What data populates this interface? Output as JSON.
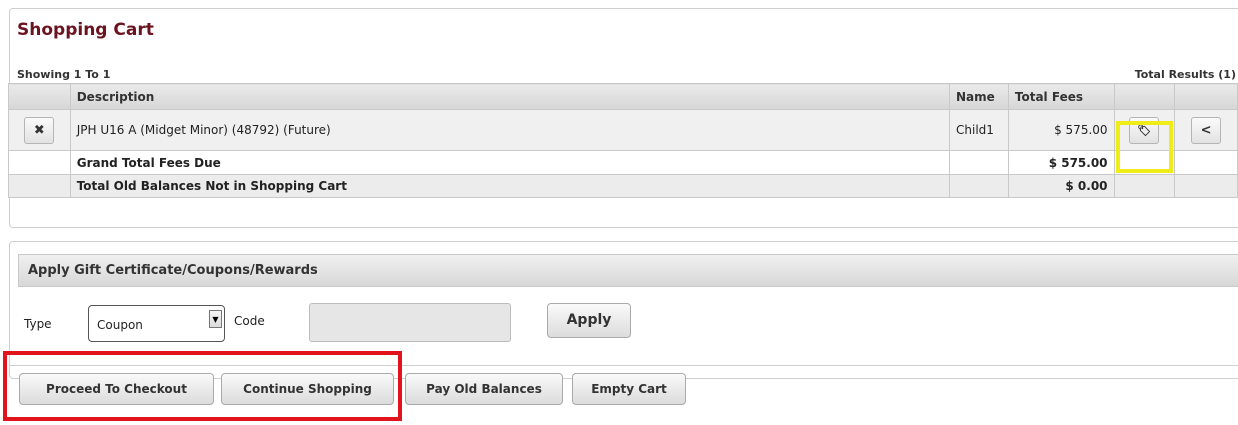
{
  "cart": {
    "title": "Shopping Cart",
    "showing": "Showing 1 To 1",
    "total_results": "Total Results (1)",
    "columns": {
      "action": "",
      "description": "Description",
      "name": "Name",
      "total_fees": "Total Fees"
    },
    "item": {
      "remove_icon": "✖",
      "description": "JPH U16 A (Midget Minor) (48792) (Future)",
      "name": "Child1",
      "fee": "$ 575.00",
      "tag_icon": "🏷",
      "share_icon": "<"
    },
    "grand_total_label": "Grand Total Fees Due",
    "grand_total_value": "$ 575.00",
    "old_balance_label": "Total Old Balances Not in Shopping Cart",
    "old_balance_value": "$ 0.00"
  },
  "coupon": {
    "header": "Apply Gift Certificate/Coupons/Rewards",
    "type_label": "Type",
    "type_value": "Coupon",
    "code_label": "Code",
    "code_value": "",
    "apply_label": "Apply"
  },
  "actions": {
    "proceed": "Proceed To Checkout",
    "continue": "Continue Shopping",
    "pay_old": "Pay Old Balances",
    "empty": "Empty Cart"
  },
  "highlight_colors": {
    "yellow": "#f0ec1a",
    "red": "#e2141b"
  }
}
